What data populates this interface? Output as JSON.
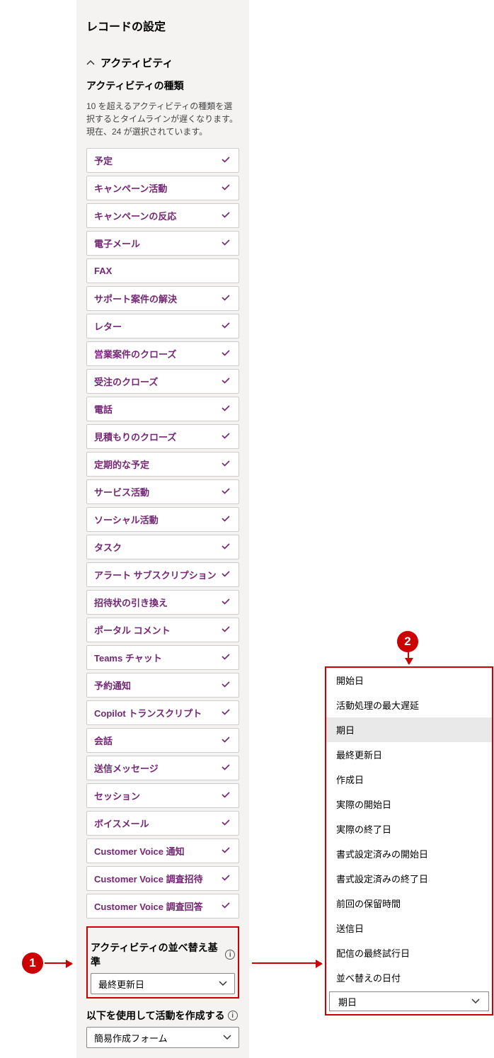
{
  "panel": {
    "title": "レコードの設定",
    "section_label": "アクティビティ",
    "subheading": "アクティビティの種類",
    "hint": "10 を超えるアクティビティの種類を選択するとタイムラインが遅くなります。\n現在、24 が選択されています。",
    "activity_types": [
      {
        "label": "予定",
        "checked": true
      },
      {
        "label": "キャンペーン活動",
        "checked": true
      },
      {
        "label": "キャンペーンの反応",
        "checked": true
      },
      {
        "label": "電子メール",
        "checked": true
      },
      {
        "label": "FAX",
        "checked": false
      },
      {
        "label": "サポート案件の解決",
        "checked": true
      },
      {
        "label": "レター",
        "checked": true
      },
      {
        "label": "営業案件のクローズ",
        "checked": true
      },
      {
        "label": "受注のクローズ",
        "checked": true
      },
      {
        "label": "電話",
        "checked": true
      },
      {
        "label": "見積もりのクローズ",
        "checked": true
      },
      {
        "label": "定期的な予定",
        "checked": true
      },
      {
        "label": "サービス活動",
        "checked": true
      },
      {
        "label": "ソーシャル活動",
        "checked": true
      },
      {
        "label": "タスク",
        "checked": true
      },
      {
        "label": "アラート サブスクリプション",
        "checked": true
      },
      {
        "label": "招待状の引き換え",
        "checked": true
      },
      {
        "label": "ポータル コメント",
        "checked": true
      },
      {
        "label": "Teams チャット",
        "checked": true
      },
      {
        "label": "予約通知",
        "checked": true
      },
      {
        "label": "Copilot トランスクリプト",
        "checked": true
      },
      {
        "label": "会話",
        "checked": true
      },
      {
        "label": "送信メッセージ",
        "checked": true
      },
      {
        "label": "セッション",
        "checked": true
      },
      {
        "label": "ボイスメール",
        "checked": true
      },
      {
        "label": "Customer Voice 通知",
        "checked": true
      },
      {
        "label": "Customer Voice 調査招待",
        "checked": true
      },
      {
        "label": "Customer Voice 調査回答",
        "checked": true
      }
    ],
    "sortby_label": "アクティビティの並べ替え基準",
    "sortby_value": "最終更新日",
    "create_label": "以下を使用して活動を作成する",
    "create_value": "簡易作成フォーム"
  },
  "annotations": {
    "badge1": "1",
    "badge2": "2"
  },
  "popup": {
    "options": [
      {
        "label": "開始日",
        "selected": false
      },
      {
        "label": "活動処理の最大遅延",
        "selected": false
      },
      {
        "label": "期日",
        "selected": true
      },
      {
        "label": "最終更新日",
        "selected": false
      },
      {
        "label": "作成日",
        "selected": false
      },
      {
        "label": "実際の開始日",
        "selected": false
      },
      {
        "label": "実際の終了日",
        "selected": false
      },
      {
        "label": "書式設定済みの開始日",
        "selected": false
      },
      {
        "label": "書式設定済みの終了日",
        "selected": false
      },
      {
        "label": "前回の保留時間",
        "selected": false
      },
      {
        "label": "送信日",
        "selected": false
      },
      {
        "label": "配信の最終試行日",
        "selected": false
      },
      {
        "label": "並べ替えの日付",
        "selected": false
      }
    ],
    "footer_value": "期日"
  }
}
